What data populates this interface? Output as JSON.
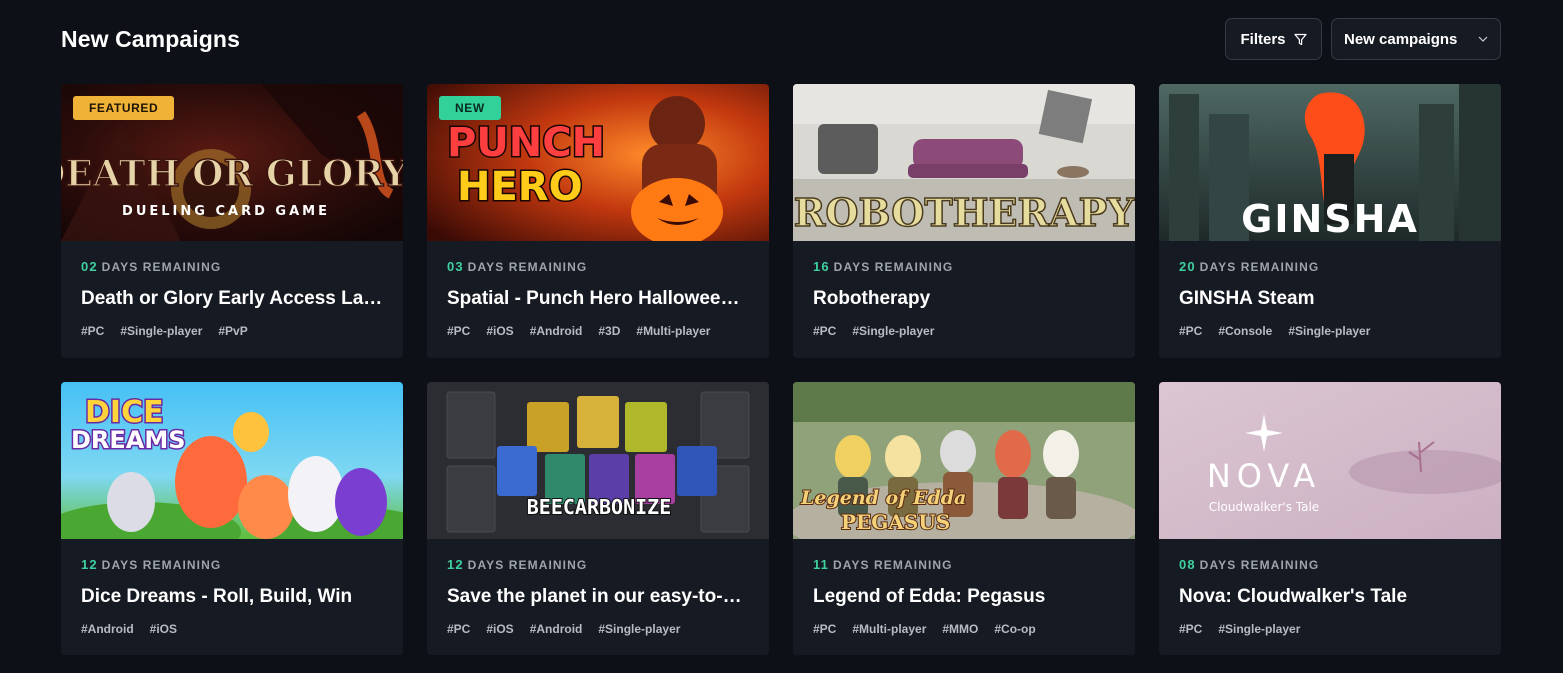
{
  "header": {
    "title": "New Campaigns",
    "filters_label": "Filters",
    "sort_label": "New campaigns"
  },
  "campaigns": [
    {
      "badge": "FEATURED",
      "image_title": "DEATH OR GLORY",
      "image_subtitle": "DUELING CARD GAME",
      "days": "02",
      "days_label": "DAYS REMAINING",
      "title": "Death or Glory Early Access La…",
      "tags": [
        "#PC",
        "#Single-player",
        "#PvP"
      ]
    },
    {
      "badge": "NEW",
      "image_title": "PUNCH",
      "image_subtitle": "HERO",
      "days": "03",
      "days_label": "DAYS REMAINING",
      "title": "Spatial - Punch Hero Hallowee…",
      "tags": [
        "#PC",
        "#iOS",
        "#Android",
        "#3D",
        "#Multi-player"
      ]
    },
    {
      "badge": "",
      "image_title": "ROBOTHERAPY",
      "image_subtitle": "",
      "days": "16",
      "days_label": "DAYS REMAINING",
      "title": "Robotherapy",
      "tags": [
        "#PC",
        "#Single-player"
      ]
    },
    {
      "badge": "",
      "image_title": "GINSHA",
      "image_subtitle": "",
      "days": "20",
      "days_label": "DAYS REMAINING",
      "title": "GINSHA Steam",
      "tags": [
        "#PC",
        "#Console",
        "#Single-player"
      ]
    },
    {
      "badge": "",
      "image_title": "DICE",
      "image_subtitle": "DREAMS",
      "days": "12",
      "days_label": "DAYS REMAINING",
      "title": "Dice Dreams - Roll, Build, Win",
      "tags": [
        "#Android",
        "#iOS"
      ]
    },
    {
      "badge": "",
      "image_title": "BEECARBONIZE",
      "image_subtitle": "",
      "days": "12",
      "days_label": "DAYS REMAINING",
      "title": "Save the planet in our easy-to-…",
      "tags": [
        "#PC",
        "#iOS",
        "#Android",
        "#Single-player"
      ]
    },
    {
      "badge": "",
      "image_title": "Legend of Edda",
      "image_subtitle": "PEGASUS",
      "days": "11",
      "days_label": "DAYS REMAINING",
      "title": "Legend of Edda: Pegasus",
      "tags": [
        "#PC",
        "#Multi-player",
        "#MMO",
        "#Co-op"
      ]
    },
    {
      "badge": "",
      "image_title": "NOVA",
      "image_subtitle": "Cloudwalker's Tale",
      "days": "08",
      "days_label": "DAYS REMAINING",
      "title": "Nova: Cloudwalker's Tale",
      "tags": [
        "#PC",
        "#Single-player"
      ]
    }
  ],
  "colors": {
    "background": "#0d1017",
    "card": "#161a22",
    "accent_green": "#3fd0a0",
    "featured_badge": "#f0b338",
    "new_badge": "#33d19a"
  }
}
